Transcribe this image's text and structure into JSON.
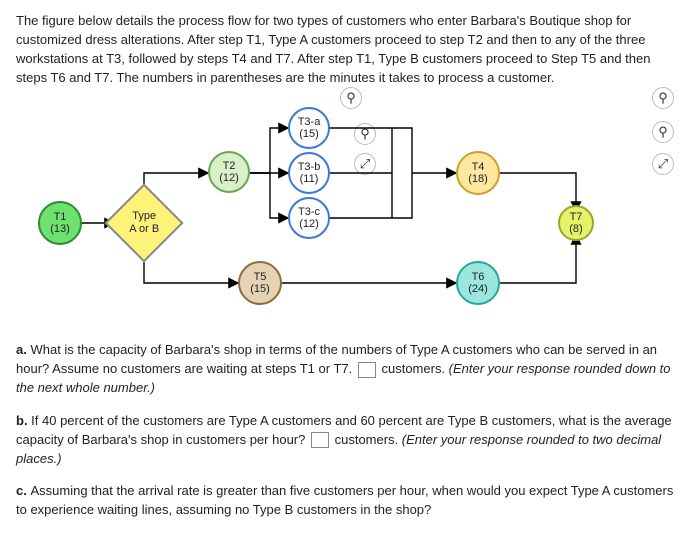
{
  "intro": "The figure below details the process flow for two types of customers who enter Barbara's Boutique shop for customized dress alterations. After step T1, Type A customers proceed to step T2 and then to any of the three workstations at T3, followed by steps T4 and T7. After step T1, Type B customers proceed to Step T5 and then steps T6 and T7. The numbers in parentheses are the minutes it takes to process a customer.",
  "nodes": {
    "t1": {
      "label": "T1",
      "time": "(13)"
    },
    "type": {
      "label": "Type",
      "sub": "A or B"
    },
    "t2": {
      "label": "T2",
      "time": "(12)"
    },
    "t3a": {
      "label": "T3-a",
      "time": "(15)"
    },
    "t3b": {
      "label": "T3-b",
      "time": "(11)"
    },
    "t3c": {
      "label": "T3-c",
      "time": "(12)"
    },
    "t4": {
      "label": "T4",
      "time": "(18)"
    },
    "t5": {
      "label": "T5",
      "time": "(15)"
    },
    "t6": {
      "label": "T6",
      "time": "(24)"
    },
    "t7": {
      "label": "T7",
      "time": "(8)"
    }
  },
  "icons": {
    "zoom": "⚲",
    "expand": "⤢"
  },
  "questions": {
    "a_pre": "a. ",
    "a_body": "What is the capacity of Barbara's shop in terms of the numbers of Type A customers who can be served in an hour? Assume no customers are waiting at steps T1 or T7.",
    "a_unit": " customers. ",
    "a_hint": "(Enter your response rounded down to the next whole number.)",
    "b_pre": "b. ",
    "b_body": "If 40 percent of the customers are Type A customers and 60 percent are Type B customers, what is the average capacity of Barbara's shop in customers per hour?",
    "b_unit": " customers. ",
    "b_hint": "(Enter your response rounded to two decimal places.)",
    "c_pre": "c. ",
    "c_body": "Assuming that the arrival rate is greater than five customers per hour, when would you expect Type A customers to experience waiting lines, assuming no Type B customers in the shop?"
  },
  "chart_data": {
    "type": "flow-diagram",
    "nodes": [
      {
        "id": "T1",
        "minutes": 13
      },
      {
        "id": "Type",
        "kind": "decision",
        "options": [
          "A",
          "B"
        ]
      },
      {
        "id": "T2",
        "minutes": 12
      },
      {
        "id": "T3-a",
        "minutes": 15
      },
      {
        "id": "T3-b",
        "minutes": 11
      },
      {
        "id": "T3-c",
        "minutes": 12
      },
      {
        "id": "T4",
        "minutes": 18
      },
      {
        "id": "T5",
        "minutes": 15
      },
      {
        "id": "T6",
        "minutes": 24
      },
      {
        "id": "T7",
        "minutes": 8
      }
    ],
    "edges": [
      [
        "T1",
        "Type"
      ],
      [
        "Type",
        "T2"
      ],
      [
        "Type",
        "T5"
      ],
      [
        "T2",
        "T3-a"
      ],
      [
        "T2",
        "T3-b"
      ],
      [
        "T2",
        "T3-c"
      ],
      [
        "T3-a",
        "T4"
      ],
      [
        "T3-b",
        "T4"
      ],
      [
        "T3-c",
        "T4"
      ],
      [
        "T5",
        "T6"
      ],
      [
        "T4",
        "T7"
      ],
      [
        "T6",
        "T7"
      ]
    ]
  }
}
